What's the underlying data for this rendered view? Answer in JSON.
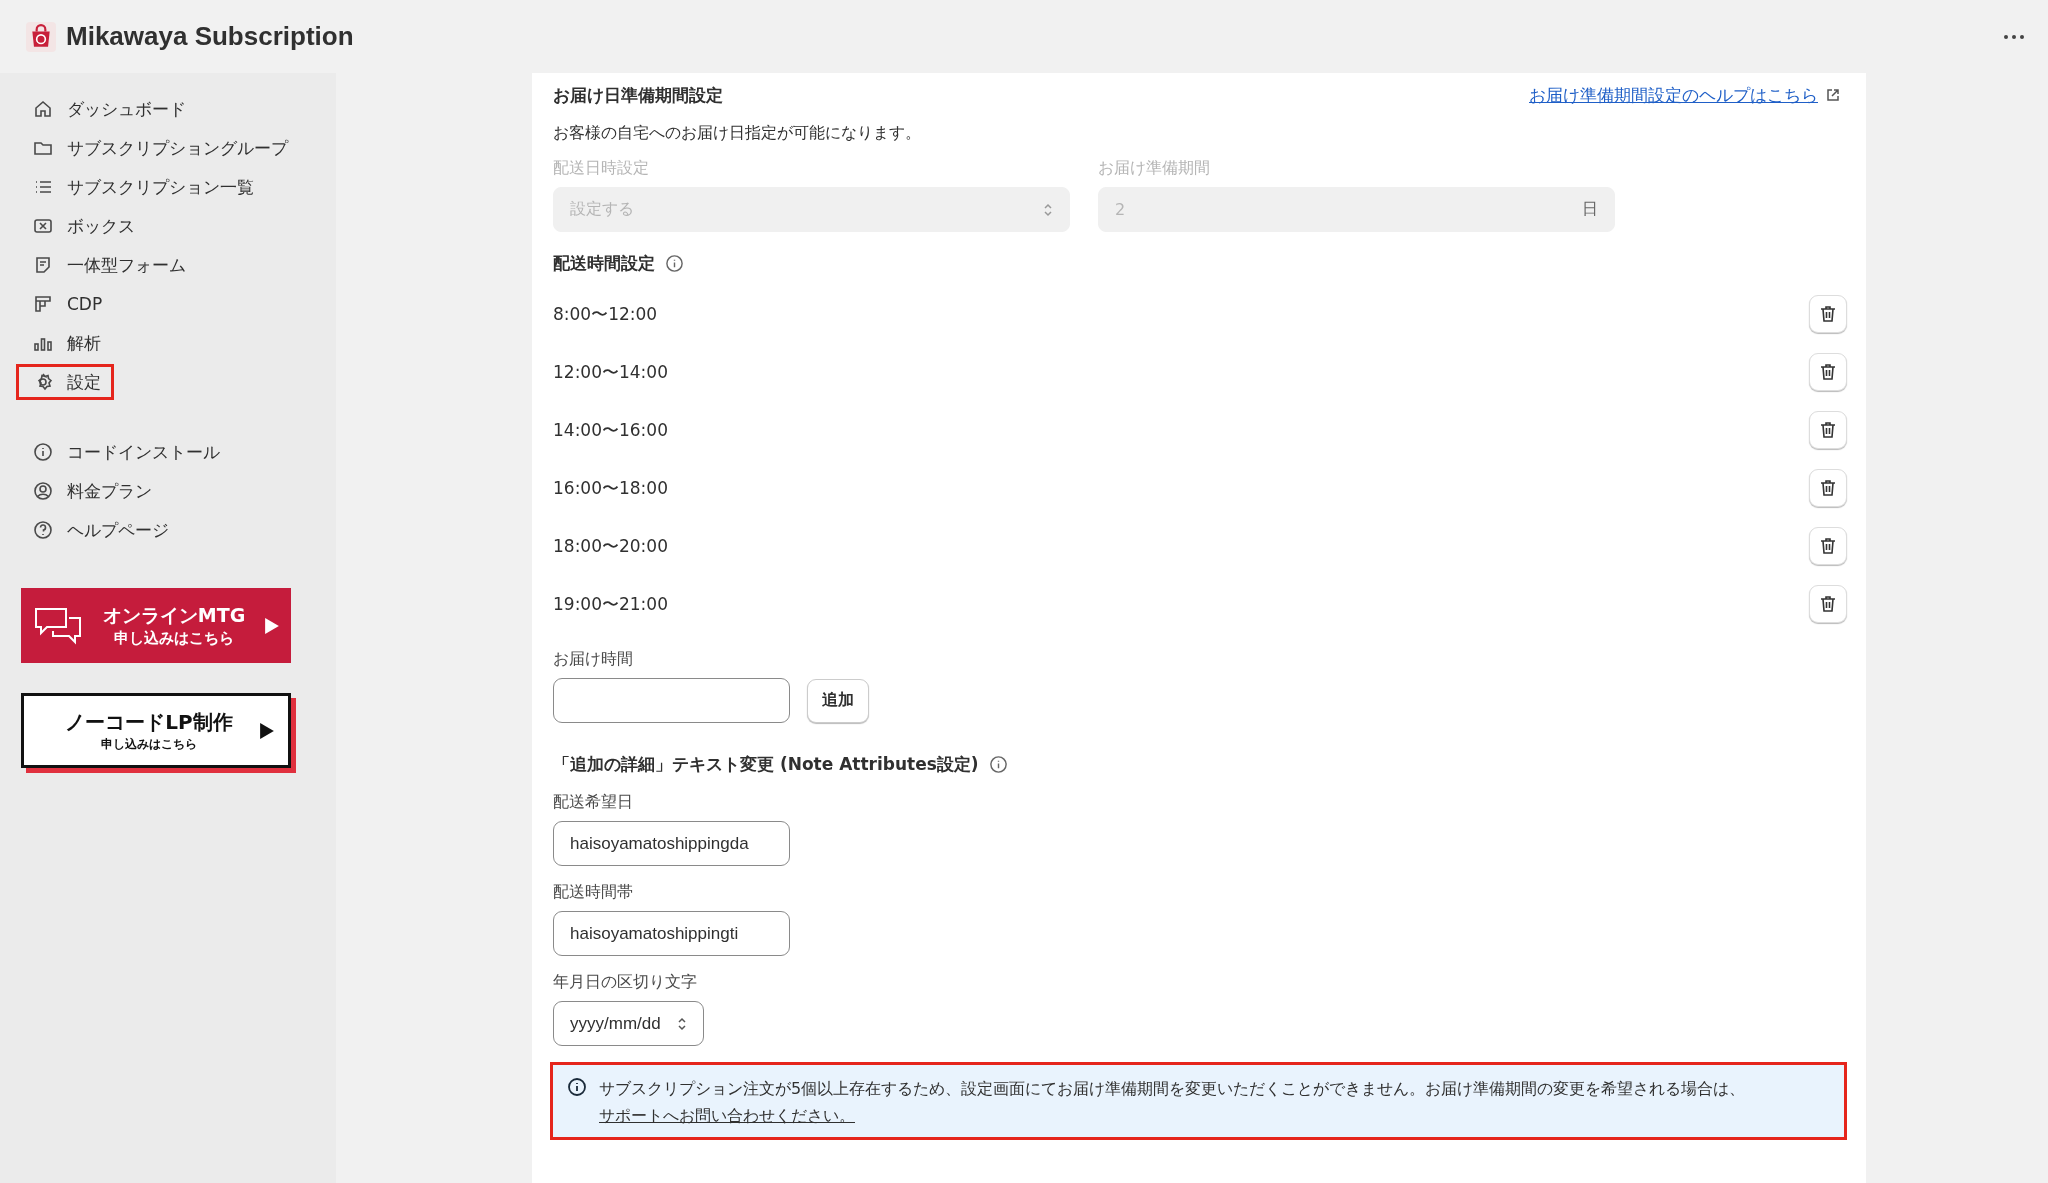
{
  "app": {
    "title": "Mikawaya Subscription"
  },
  "sidebar": {
    "items": [
      {
        "label": "ダッシュボード",
        "highlighted": false
      },
      {
        "label": "サブスクリプショングループ",
        "highlighted": false
      },
      {
        "label": "サブスクリプション一覧",
        "highlighted": false
      },
      {
        "label": "ボックス",
        "highlighted": false
      },
      {
        "label": "一体型フォーム",
        "highlighted": false
      },
      {
        "label": "CDP",
        "highlighted": false
      },
      {
        "label": "解析",
        "highlighted": false
      },
      {
        "label": "設定",
        "highlighted": true
      }
    ],
    "secondary_items": [
      {
        "label": "コードインストール"
      },
      {
        "label": "料金プラン"
      },
      {
        "label": "ヘルプページ"
      }
    ],
    "banners": [
      {
        "kind": "filled",
        "title": "オンラインMTG",
        "subtitle": "申し込みはこちら"
      },
      {
        "kind": "outlined",
        "title": "ノーコードLP制作",
        "subtitle": "申し込みはこちら"
      }
    ]
  },
  "delivery_prep": {
    "title": "お届け日準備期間設定",
    "help_link": "お届け準備期間設定のヘルプはこちら",
    "description": "お客様の自宅へのお届け日指定が可能になります。",
    "fields": [
      {
        "kind": "select",
        "label": "配送日時設定",
        "value": "設定する",
        "disabled": true
      },
      {
        "kind": "suffix",
        "label": "お届け準備期間",
        "value": "2",
        "suffix": "日",
        "disabled": true
      }
    ]
  },
  "time_slots": {
    "title": "配送時間設定",
    "items": [
      "8:00〜12:00",
      "12:00〜14:00",
      "14:00〜16:00",
      "16:00〜18:00",
      "18:00〜20:00",
      "19:00〜21:00"
    ],
    "add_label": "お届け時間",
    "add_button": "追加"
  },
  "note_attributes": {
    "title": "「追加の詳細」テキスト変更 (Note Attributes設定)",
    "fields": [
      {
        "kind": "text",
        "label": "配送希望日",
        "value": "haisoyamatoshippingda"
      },
      {
        "kind": "text",
        "label": "配送時間帯",
        "value": "haisoyamatoshippingti"
      },
      {
        "kind": "select",
        "label": "年月日の区切り文字",
        "value": "yyyy/mm/dd"
      }
    ]
  },
  "notice": {
    "text": "サブスクリプション注文が5個以上存在するため、設定画面にてお届け準備期間を変更いただくことができません。お届け準備期間の変更を希望される場合は、",
    "link": "サポートへお問い合わせください。",
    "highlighted": true
  }
}
